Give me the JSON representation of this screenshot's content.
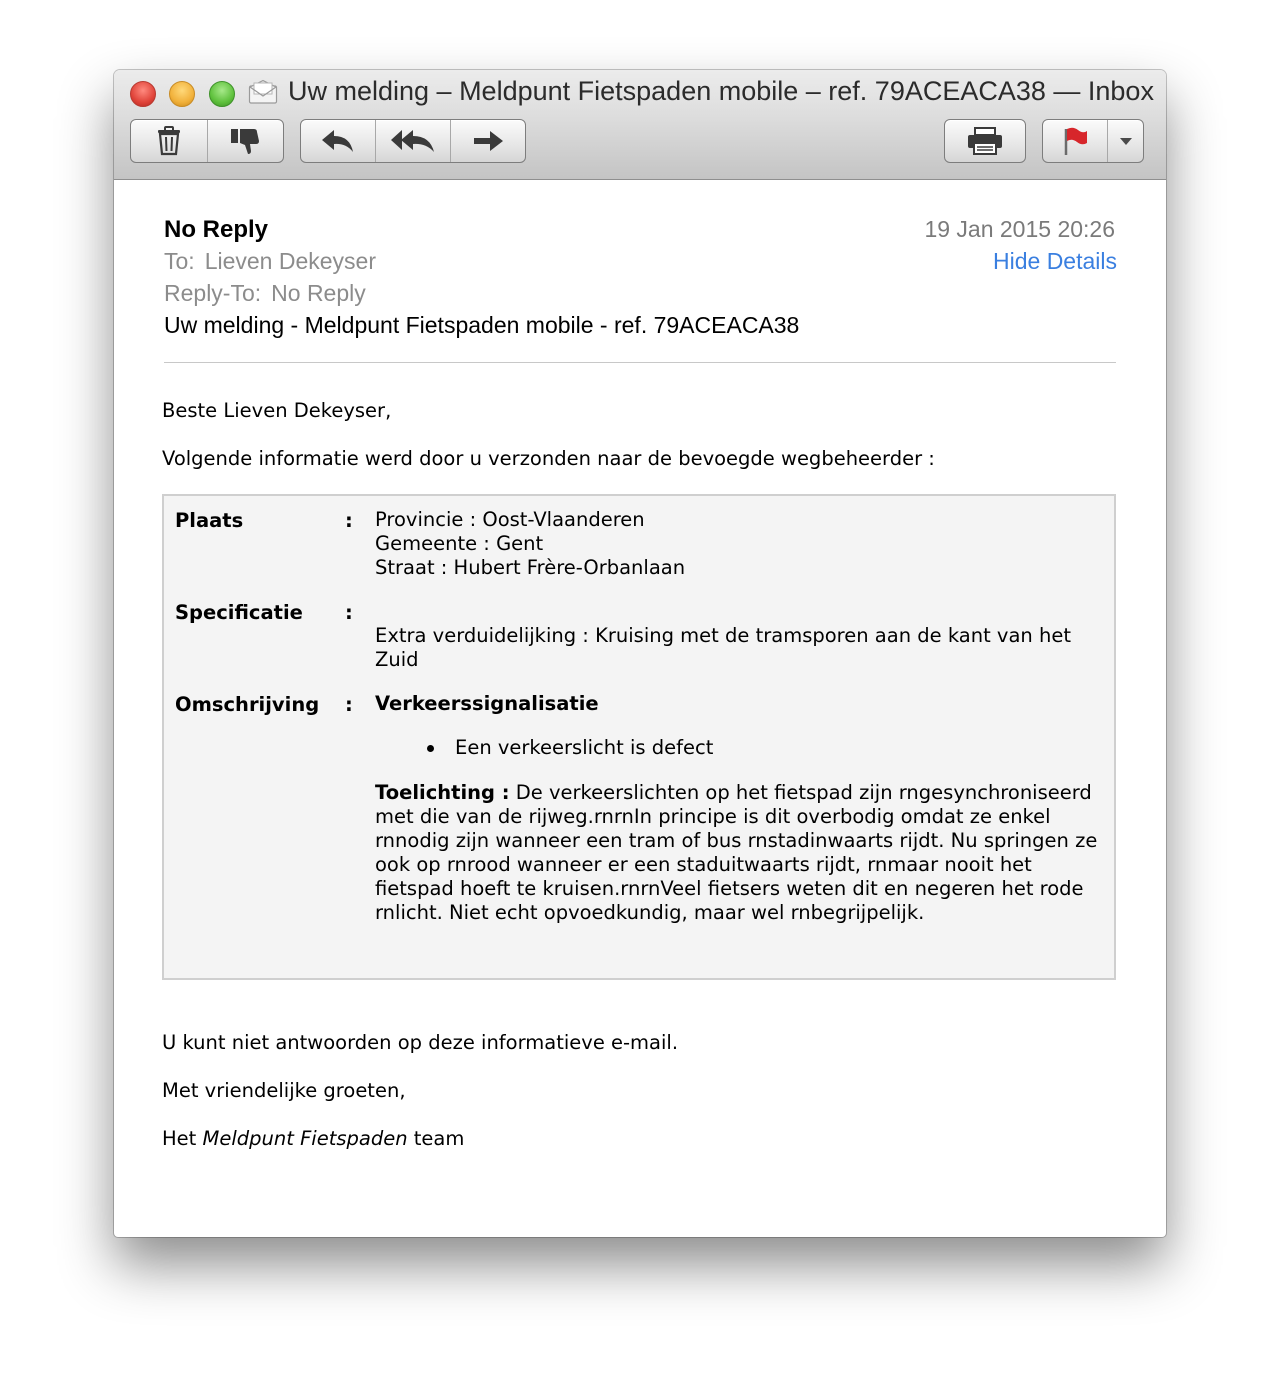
{
  "window": {
    "title": "Uw melding – Meldpunt Fietspaden mobile – ref. 79ACEACA38 — Inbox"
  },
  "toolbar": {
    "delete_icon": "trash-icon",
    "junk_icon": "thumbs-down-icon",
    "reply_icon": "reply-icon",
    "reply_all_icon": "reply-all-icon",
    "forward_icon": "forward-icon",
    "print_icon": "printer-icon",
    "flag_icon": "flag-icon",
    "flag_color": "#d7262b"
  },
  "header": {
    "from": "No Reply",
    "date": "19 Jan 2015 20:26",
    "to_label": "To:",
    "to_value": "Lieven Dekeyser",
    "reply_to_label": "Reply-To:",
    "reply_to_value": "No Reply",
    "hide_details": "Hide Details",
    "subject": "Uw melding - Meldpunt Fietspaden mobile - ref. 79ACEACA38",
    "link_color": "#3a7fe0"
  },
  "body": {
    "greeting": "Beste Lieven Dekeyser,",
    "intro": "Volgende informatie werd door u verzonden naar de bevoegde wegbeheerder :",
    "info": {
      "plaats_label": "Plaats",
      "specificatie_label": "Specificatie",
      "omschrijving_label": "Omschrijving",
      "colon": ":",
      "provincie": "Provincie : Oost-Vlaanderen",
      "gemeente": "Gemeente : Gent",
      "straat": "Straat : Hubert Frère-Orbanlaan",
      "extra_line1": "Extra verduidelijking : Kruising met de tramsporen aan de kant van het",
      "extra_line2": "Zuid",
      "category": "Verkeerssignalisatie",
      "bullet": "Een verkeerslicht is defect",
      "toelichting_label": "Toelichting :",
      "toelichting_text": "De verkeerslichten op het fietspad zijn rngesynchroniseerd met die van de rijweg.rnrnIn principe is dit overbodig omdat ze enkel rnnodig zijn wanneer een tram of bus rnstadinwaarts rijdt. Nu springen ze ook op rnrood wanneer er een staduitwaarts rijdt, rnmaar nooit het fietspad hoeft te kruisen.rnrnVeel fietsers weten dit en negeren het rode rnlicht. Niet echt opvoedkundig, maar wel rnbegrijpelijk."
    },
    "no_reply_note": "U kunt niet antwoorden op deze informatieve e-mail.",
    "regards": "Met vriendelijke groeten,",
    "sign_prefix": "Het",
    "sign_name": "Meldpunt Fietspaden",
    "sign_suffix": "team"
  }
}
